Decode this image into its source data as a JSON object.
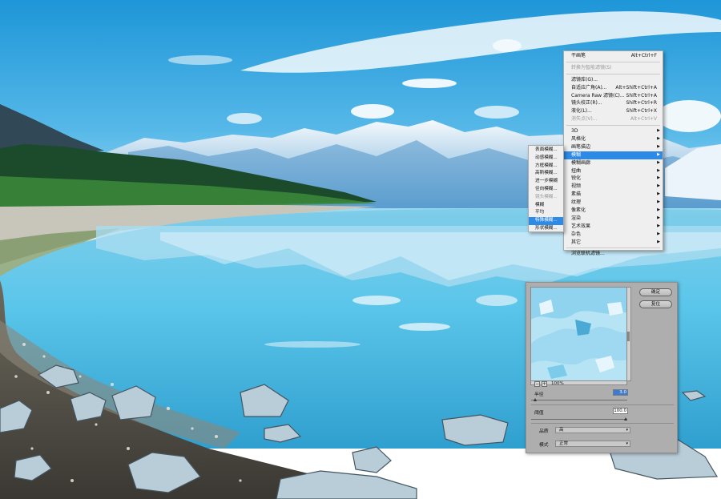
{
  "filter_menu": {
    "items": [
      {
        "label": "干画笔",
        "shortcut": "Alt+Ctrl+F",
        "disabled": false
      },
      {
        "separator": true
      },
      {
        "label": "转换为智能滤镜(S)",
        "disabled": true
      },
      {
        "separator": true
      },
      {
        "label": "滤镜库(G)...",
        "shortcut": ""
      },
      {
        "label": "自适应广角(A)...",
        "shortcut": "Alt+Shift+Ctrl+A"
      },
      {
        "label": "Camera Raw 滤镜(C)...",
        "shortcut": "Shift+Ctrl+A"
      },
      {
        "label": "镜头校正(R)...",
        "shortcut": "Shift+Ctrl+R"
      },
      {
        "label": "液化(L)...",
        "shortcut": "Shift+Ctrl+X"
      },
      {
        "label": "消失点(V)...",
        "shortcut": "Alt+Ctrl+V",
        "disabled": true
      },
      {
        "separator": true
      },
      {
        "label": "3D",
        "submenu": true
      },
      {
        "label": "风格化",
        "submenu": true
      },
      {
        "label": "画笔描边",
        "submenu": true
      },
      {
        "label": "模糊",
        "submenu": true,
        "highlighted": true
      },
      {
        "label": "模糊画廊",
        "submenu": true
      },
      {
        "label": "扭曲",
        "submenu": true
      },
      {
        "label": "锐化",
        "submenu": true
      },
      {
        "label": "视频",
        "submenu": true
      },
      {
        "label": "素描",
        "submenu": true
      },
      {
        "label": "纹理",
        "submenu": true
      },
      {
        "label": "像素化",
        "submenu": true
      },
      {
        "label": "渲染",
        "submenu": true
      },
      {
        "label": "艺术效果",
        "submenu": true
      },
      {
        "label": "杂色",
        "submenu": true
      },
      {
        "label": "其它",
        "submenu": true
      },
      {
        "separator": true
      },
      {
        "label": "浏览联机滤镜..."
      }
    ]
  },
  "blur_submenu": {
    "items": [
      {
        "label": "表面模糊..."
      },
      {
        "label": "动感模糊..."
      },
      {
        "label": "方框模糊..."
      },
      {
        "label": "高斯模糊..."
      },
      {
        "label": "进一步模糊"
      },
      {
        "label": "径向模糊..."
      },
      {
        "label": "镜头模糊...",
        "disabled": true
      },
      {
        "label": "模糊"
      },
      {
        "label": "平均"
      },
      {
        "label": "特殊模糊...",
        "highlighted": true
      },
      {
        "label": "形状模糊..."
      }
    ]
  },
  "dialog": {
    "ok_label": "确定",
    "cancel_label": "复位",
    "zoom_out": "−",
    "zoom_in": "+",
    "zoom_value": "100%",
    "radius_label": "半径",
    "radius_value": "3.0",
    "threshold_label": "阈值",
    "threshold_value": "100.0",
    "quality_label": "品质",
    "quality_value": "高",
    "mode_label": "模式",
    "mode_value": "正常"
  },
  "colors": {
    "menu_highlight": "#2d8ae6",
    "dialog_bg": "#aeaeae",
    "menu_bg": "#efefef"
  }
}
